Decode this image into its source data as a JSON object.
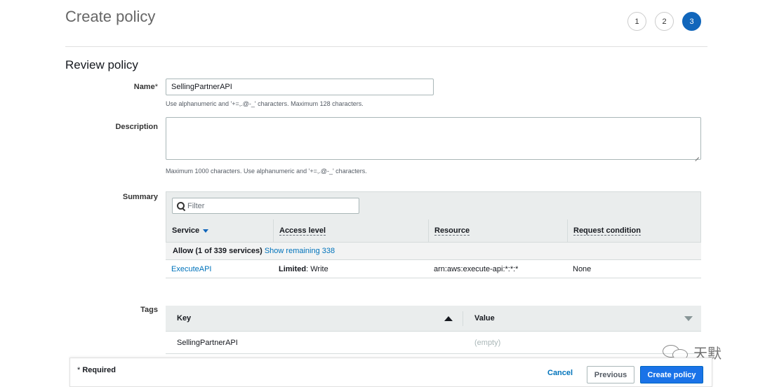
{
  "header": {
    "title": "Create policy",
    "steps": [
      "1",
      "2",
      "3"
    ],
    "active_step": "3"
  },
  "review": {
    "section_title": "Review policy",
    "name_label": "Name",
    "required_marker": "*",
    "name_value": "SellingPartnerAPI",
    "name_hint": "Use alphanumeric and '+=,.@-_' characters. Maximum 128 characters.",
    "description_label": "Description",
    "description_value": "",
    "description_hint": "Maximum 1000 characters. Use alphanumeric and '+=,.@-_' characters."
  },
  "summary": {
    "label": "Summary",
    "filter_placeholder": "Filter",
    "columns": [
      "Service",
      "Access level",
      "Resource",
      "Request condition"
    ],
    "allow_text": "Allow (1 of 339 services)",
    "show_remaining": "Show remaining 338",
    "rows": [
      {
        "service": "ExecuteAPI",
        "access_level_bold": "Limited",
        "access_level_rest": ": Write",
        "resource": "arn:aws:execute-api:*:*:*",
        "condition": "None"
      }
    ]
  },
  "tags": {
    "label": "Tags",
    "key_header": "Key",
    "value_header": "Value",
    "rows": [
      {
        "key": "SellingPartnerAPI",
        "value": "(empty)"
      }
    ]
  },
  "footer": {
    "required_note": "Required",
    "required_marker": "*",
    "cancel": "Cancel",
    "previous": "Previous",
    "create": "Create policy"
  },
  "watermark": {
    "text": "天默"
  },
  "colors": {
    "primary": "#1a73e8",
    "link": "#0073bb",
    "header_bg": "#eaeded"
  }
}
